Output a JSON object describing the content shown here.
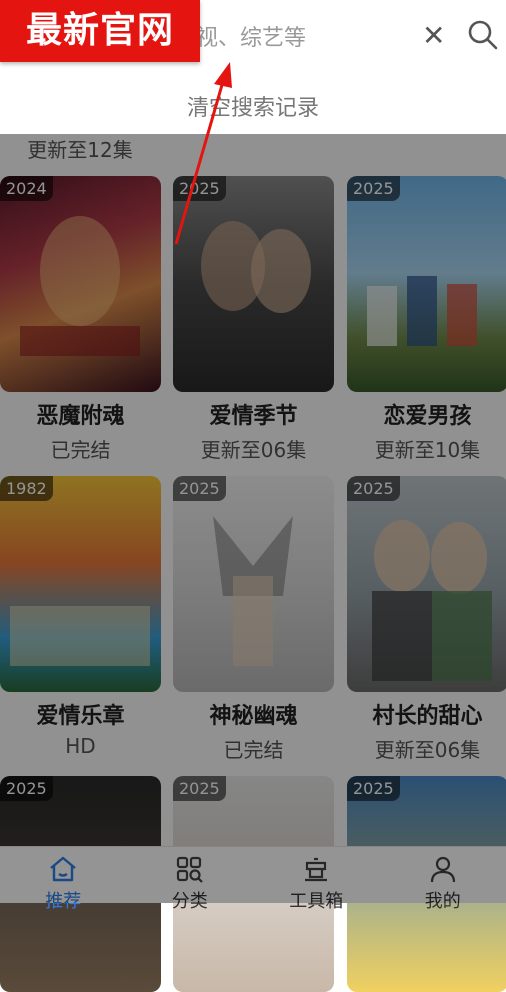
{
  "search": {
    "placeholder": "视、综艺等",
    "clear_icon": "close-icon",
    "search_icon": "search-icon",
    "clear_history_label": "清空搜索记录"
  },
  "watermark": {
    "text": "最新官网"
  },
  "prev_row_sub": "更新至12集",
  "cards": [
    {
      "year": "2024",
      "title": "恶魔附魂",
      "sub": "已完结"
    },
    {
      "year": "2025",
      "title": "爱情季节",
      "sub": "更新至06集"
    },
    {
      "year": "2025",
      "title": "恋爱男孩",
      "sub": "更新至10集"
    },
    {
      "year": "1982",
      "title": "爱情乐章",
      "sub": "HD"
    },
    {
      "year": "2025",
      "title": "神秘幽魂",
      "sub": "已完结"
    },
    {
      "year": "2025",
      "title": "村长的甜心",
      "sub": "更新至06集"
    },
    {
      "year": "2025",
      "title": "",
      "sub": ""
    },
    {
      "year": "2025",
      "title": "",
      "sub": ""
    },
    {
      "year": "2025",
      "title": "",
      "sub": ""
    }
  ],
  "nav": [
    {
      "label": "推荐",
      "icon": "home-icon",
      "active": true
    },
    {
      "label": "分类",
      "icon": "category-search-icon",
      "active": false
    },
    {
      "label": "工具箱",
      "icon": "toolbox-icon",
      "active": false
    },
    {
      "label": "我的",
      "icon": "profile-icon",
      "active": false
    }
  ],
  "colors": {
    "accent": "#2d7ee8",
    "watermark": "#e41410"
  }
}
